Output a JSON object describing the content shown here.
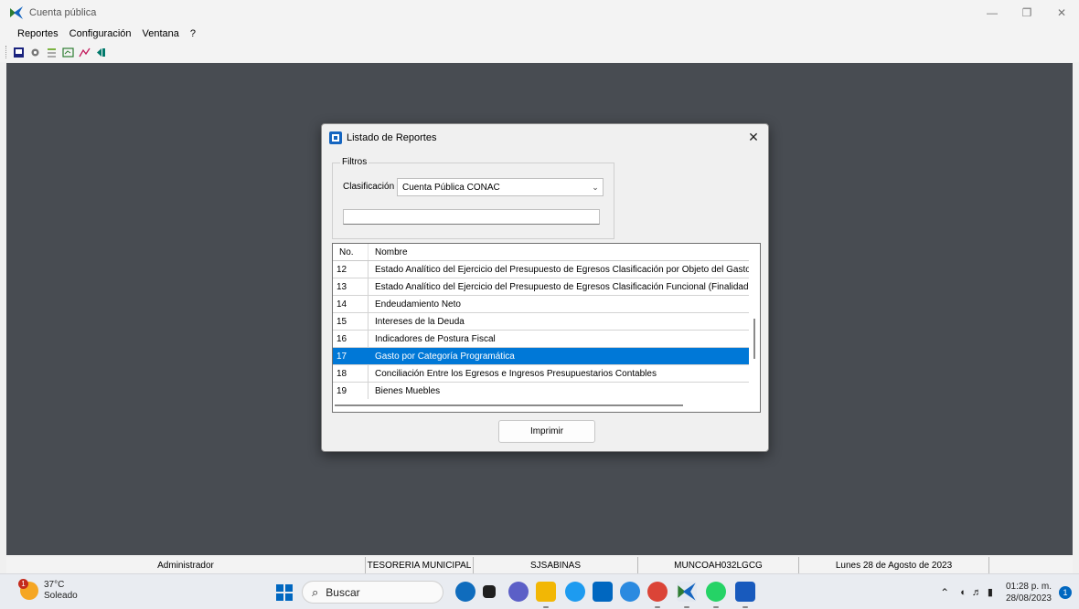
{
  "window": {
    "title": "Cuenta pública",
    "controls": [
      "—",
      "❐",
      "✕"
    ]
  },
  "menu": [
    "Reportes",
    "Configuración",
    "Ventana",
    "?"
  ],
  "toolbar_icons": [
    "report-icon",
    "connect-icon",
    "list-icon",
    "config-icon",
    "chart-icon",
    "exit-icon"
  ],
  "dialog": {
    "title": "Listado de Reportes",
    "close": "✕",
    "filters_legend": "Filtros",
    "clasificacion_label": "Clasificación",
    "clasificacion_value": "Cuenta Pública CONAC",
    "text_filter_value": "",
    "grid": {
      "col_no": "No.",
      "col_nombre": "Nombre",
      "rows": [
        {
          "no": "12",
          "nombre": "Estado Analítico del Ejercicio del Presupuesto de Egresos Clasificación por Objeto del Gasto (Capítu"
        },
        {
          "no": "13",
          "nombre": "Estado Analítico del Ejercicio del Presupuesto de Egresos Clasificación Funcional (Finalidad y Funci"
        },
        {
          "no": "14",
          "nombre": "Endeudamiento Neto"
        },
        {
          "no": "15",
          "nombre": "Intereses de la Deuda"
        },
        {
          "no": "16",
          "nombre": "Indicadores de Postura Fiscal"
        },
        {
          "no": "17",
          "nombre": "Gasto por Categoría Programática"
        },
        {
          "no": "18",
          "nombre": "Conciliación Entre los Egresos e Ingresos Presupuestarios Contables"
        },
        {
          "no": "19",
          "nombre": "Bienes Muebles"
        }
      ],
      "selected_index": 5
    },
    "print_button": "Imprimir"
  },
  "statusbar": [
    "Administrador",
    "TESORERIA MUNICIPAL",
    "SJSABINAS",
    "MUNCOAH032LGCG",
    "Lunes 28 de Agosto de 2023",
    ""
  ],
  "taskbar": {
    "weather_temp": "37°C",
    "weather_desc": "Soleado",
    "weather_badge": "1",
    "search_placeholder": "Buscar",
    "time": "01:28 p. m.",
    "date": "28/08/2023",
    "notifications": "1"
  },
  "colors": {
    "mdi_background": "#484c52",
    "selection": "#0078d7",
    "windows_accent": "#0067c0"
  }
}
